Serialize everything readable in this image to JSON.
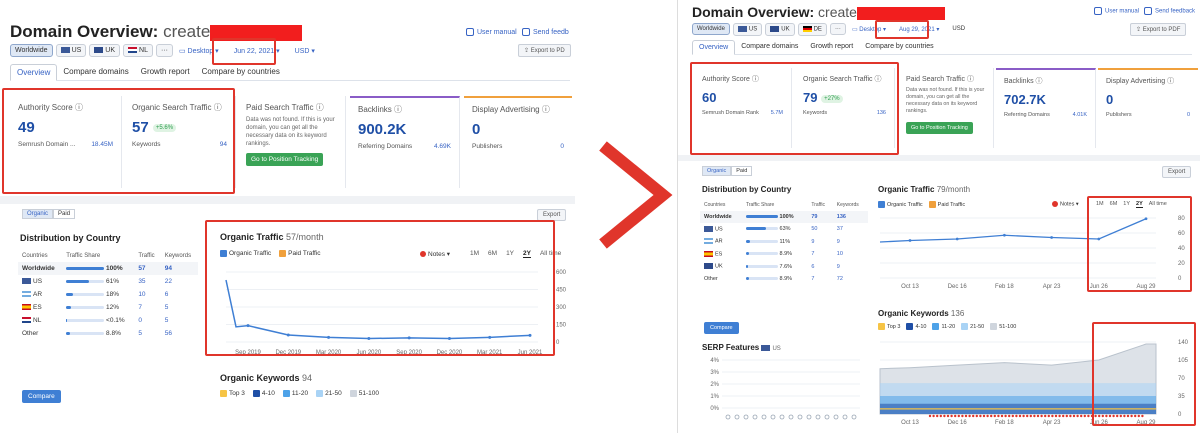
{
  "left": {
    "title": "Domain Overview:",
    "domain": "create",
    "user_manual": "User manual",
    "send_feedback": "Send feedb",
    "db_buttons": [
      "Worldwide",
      "US",
      "UK",
      "NL",
      "···"
    ],
    "device": "Desktop",
    "date": "Jun 22, 2021",
    "currency": "USD",
    "export_pdf": "Export to PD",
    "tabs": [
      "Overview",
      "Compare domains",
      "Growth report",
      "Compare by countries"
    ],
    "authority": {
      "label": "Authority Score",
      "value": "49",
      "sub_label": "Semrush Domain ...",
      "sub_value": "18.45M"
    },
    "organic": {
      "label": "Organic Search Traffic",
      "value": "57",
      "badge": "+5.6%",
      "sub_label": "Keywords",
      "sub_value": "94"
    },
    "paid": {
      "label": "Paid Search Traffic",
      "note": "Data was not found. If this is your domain, you can get all the necessary data on its keyword rankings.",
      "button": "Go to Position Tracking"
    },
    "backlinks": {
      "label": "Backlinks",
      "value": "900.2K",
      "sub_label": "Referring Domains",
      "sub_value": "4.69K"
    },
    "display": {
      "label": "Display Advertising",
      "value": "0",
      "sub_label": "Publishers",
      "sub_value": "0"
    },
    "toggle": [
      "Organic",
      "Paid"
    ],
    "export": "Export",
    "dist_title": "Distribution by Country",
    "dist_headers": [
      "Countries",
      "Traffic Share",
      "Traffic",
      "Keywords"
    ],
    "dist_rows": [
      {
        "country": "Worldwide",
        "share": "100%",
        "traffic": "57",
        "keywords": "94",
        "pct": 1.0
      },
      {
        "country": "US",
        "share": "61%",
        "traffic": "35",
        "keywords": "22",
        "pct": 0.61
      },
      {
        "country": "AR",
        "share": "18%",
        "traffic": "10",
        "keywords": "6",
        "pct": 0.18
      },
      {
        "country": "ES",
        "share": "12%",
        "traffic": "7",
        "keywords": "5",
        "pct": 0.12
      },
      {
        "country": "NL",
        "share": "<0.1%",
        "traffic": "0",
        "keywords": "5",
        "pct": 0.01
      },
      {
        "country": "Other",
        "share": "8.8%",
        "traffic": "5",
        "keywords": "56",
        "pct": 0.088
      }
    ],
    "compare": "Compare",
    "ot_title": "Organic Traffic",
    "ot_sub": "57/month",
    "ot_legend": [
      "Organic Traffic",
      "Paid Traffic"
    ],
    "notes": "Notes",
    "ranges": [
      "1M",
      "6M",
      "1Y",
      "2Y",
      "All time"
    ],
    "ot_yticks": [
      "600",
      "450",
      "300",
      "150",
      "0"
    ],
    "ot_xticks": [
      "Sep 2019",
      "Dec 2019",
      "Mar 2020",
      "Jun 2020",
      "Sep 2020",
      "Dec 2020",
      "Mar 2021",
      "Jun 2021"
    ],
    "ok_title": "Organic Keywords",
    "ok_sub": "94",
    "ok_legend": [
      "Top 3",
      "4-10",
      "11-20",
      "21-50",
      "51-100"
    ]
  },
  "right": {
    "title": "Domain Overview:",
    "domain": "create",
    "user_manual": "User manual",
    "send_feedback": "Send feedback",
    "db_buttons": [
      "Worldwide",
      "US",
      "UK",
      "DE",
      "···"
    ],
    "device": "Desktop",
    "date": "Aug 29, 2021",
    "currency": "USD",
    "export_pdf": "Export to PDF",
    "tabs": [
      "Overview",
      "Compare domains",
      "Growth report",
      "Compare by countries"
    ],
    "authority": {
      "label": "Authority Score",
      "value": "60",
      "sub_label": "Semrush Domain Rank",
      "sub_value": "5.7M"
    },
    "organic": {
      "label": "Organic Search Traffic",
      "value": "79",
      "badge": "+27%",
      "sub_label": "Keywords",
      "sub_value": "136"
    },
    "paid": {
      "label": "Paid Search Traffic",
      "note": "Data was not found. If this is your domain, you can get all the necessary data on its keyword rankings.",
      "button": "Go to Position Tracking"
    },
    "backlinks": {
      "label": "Backlinks",
      "value": "702.7K",
      "sub_label": "Referring Domains",
      "sub_value": "4.01K"
    },
    "display": {
      "label": "Display Advertising",
      "value": "0",
      "sub_label": "Publishers",
      "sub_value": "0"
    },
    "toggle": [
      "Organic",
      "Paid"
    ],
    "export": "Export",
    "dist_title": "Distribution by Country",
    "dist_headers": [
      "Countries",
      "Traffic Share",
      "Traffic",
      "Keywords"
    ],
    "dist_rows": [
      {
        "country": "Worldwide",
        "share": "100%",
        "traffic": "79",
        "keywords": "136",
        "pct": 1.0
      },
      {
        "country": "US",
        "share": "63%",
        "traffic": "50",
        "keywords": "37",
        "pct": 0.63
      },
      {
        "country": "AR",
        "share": "11%",
        "traffic": "9",
        "keywords": "9",
        "pct": 0.11
      },
      {
        "country": "ES",
        "share": "8.9%",
        "traffic": "7",
        "keywords": "10",
        "pct": 0.089
      },
      {
        "country": "UK",
        "share": "7.6%",
        "traffic": "6",
        "keywords": "9",
        "pct": 0.076
      },
      {
        "country": "Other",
        "share": "8.9%",
        "traffic": "7",
        "keywords": "72",
        "pct": 0.089
      }
    ],
    "compare": "Compare",
    "serp_title": "SERP Features",
    "serp_db": "US",
    "serp_yticks": [
      "4%",
      "3%",
      "2%",
      "1%",
      "0%"
    ],
    "ot_title": "Organic Traffic",
    "ot_sub": "79/month",
    "ot_legend": [
      "Organic Traffic",
      "Paid Traffic"
    ],
    "notes": "Notes",
    "ranges": [
      "1M",
      "6M",
      "1Y",
      "2Y",
      "All time"
    ],
    "ot_yticks": [
      "80",
      "60",
      "40",
      "20",
      "0"
    ],
    "ot_xticks": [
      "Oct 13",
      "Dec 16",
      "Feb 18",
      "Apr 23",
      "Jun 26",
      "Aug 29"
    ],
    "ok_title": "Organic Keywords",
    "ok_sub": "136",
    "ok_legend": [
      "Top 3",
      "4-10",
      "11-20",
      "21-50",
      "51-100"
    ],
    "ok_yticks": [
      "140",
      "105",
      "70",
      "35",
      "0"
    ],
    "ok_xticks": [
      "Oct 13",
      "Dec 16",
      "Feb 18",
      "Apr 23",
      "Jun 26",
      "Aug 29"
    ]
  },
  "colors": {
    "accent": "#3763c4",
    "highlight": "#e0352b",
    "green": "#3aa356",
    "line": "#3f7fd4",
    "paid": "#f0a03c"
  },
  "chart_data": [
    {
      "type": "line",
      "title": "Organic Traffic",
      "x": [
        "Sep 2019",
        "Dec 2019",
        "Mar 2020",
        "Jun 2020",
        "Sep 2020",
        "Dec 2020",
        "Mar 2021",
        "Jun 2021"
      ],
      "series": [
        {
          "name": "Organic Traffic",
          "values": [
            140,
            60,
            40,
            30,
            35,
            30,
            40,
            57
          ]
        }
      ],
      "ylim": [
        0,
        600
      ]
    },
    {
      "type": "line",
      "title": "Organic Traffic",
      "x": [
        "Oct 13",
        "Dec 16",
        "Feb 18",
        "Apr 23",
        "Jun 26",
        "Aug 29"
      ],
      "series": [
        {
          "name": "Organic Traffic",
          "values": [
            50,
            52,
            57,
            54,
            52,
            79
          ]
        }
      ],
      "ylim": [
        0,
        80
      ]
    },
    {
      "type": "area",
      "title": "Organic Keywords",
      "x": [
        "Oct 13",
        "Dec 16",
        "Feb 18",
        "Apr 23",
        "Jun 26",
        "Aug 29"
      ],
      "series": [
        {
          "name": "Top 3",
          "values": [
            10,
            10,
            10,
            10,
            10,
            10
          ]
        },
        {
          "name": "51-100",
          "values": [
            90,
            95,
            100,
            95,
            105,
            136
          ]
        }
      ],
      "ylim": [
        0,
        140
      ]
    }
  ]
}
